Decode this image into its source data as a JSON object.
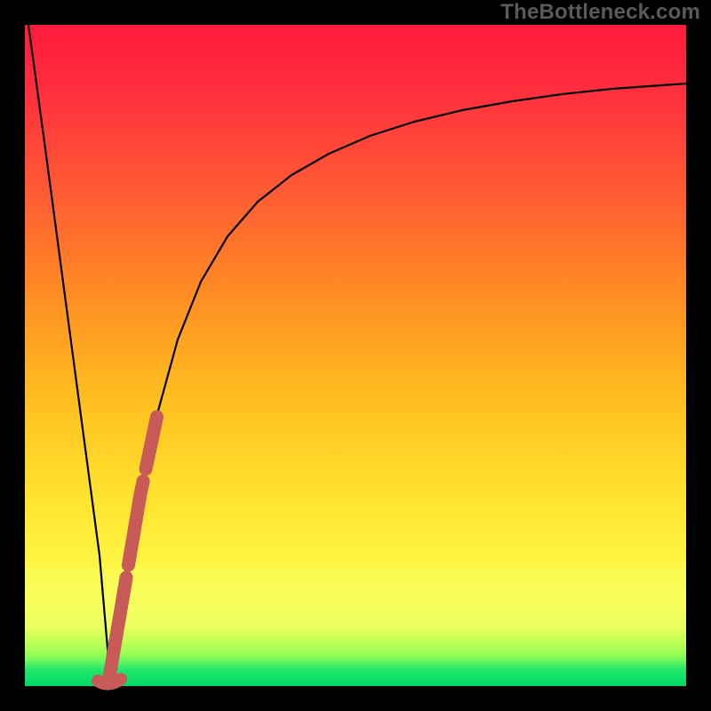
{
  "watermark": "TheBottleneck.com",
  "colors": {
    "frame": "#000000",
    "curve": "#000000",
    "highlight": "#c85a57",
    "grad_top": "#ff1a3c",
    "grad_mid1": "#ff522f",
    "grad_mid2": "#ff8a1f",
    "grad_mid3": "#ffc81a",
    "grad_mid4": "#fff23a",
    "grad_low": "#f8ff6a",
    "grad_band_top": "#eaff5e",
    "grad_band_bottom": "#b6ff55",
    "grad_green": "#00e36a"
  },
  "chart_data": {
    "type": "line",
    "title": "",
    "xlabel": "",
    "ylabel": "",
    "xlim": [
      0,
      100
    ],
    "ylim": [
      0,
      100
    ],
    "series": [
      {
        "name": "bottleneck-curve",
        "x": [
          0,
          3,
          6,
          9,
          12,
          12.5,
          15,
          18,
          21,
          24,
          27,
          30,
          34,
          38,
          42,
          46,
          50,
          55,
          60,
          65,
          70,
          75,
          80,
          85,
          90,
          95,
          100
        ],
        "y": [
          100,
          76,
          52,
          28,
          4,
          0,
          16,
          32,
          46,
          57,
          65,
          71,
          76,
          79.5,
          82,
          84,
          85.5,
          87,
          88.2,
          89.1,
          89.8,
          90.4,
          90.9,
          91.3,
          91.6,
          91.8,
          92
        ]
      }
    ],
    "highlight_segment": {
      "name": "highlight-band",
      "x_start": 12.2,
      "x_end": 24,
      "note": "Thick salmon dashed stroke overlaid on rising portion of curve"
    },
    "regions": [
      {
        "name": "top-red",
        "y_range": [
          95,
          100
        ],
        "color_key": "grad_top"
      },
      {
        "name": "red-orange",
        "y_range": [
          50,
          95
        ],
        "color_key": "grad_mid2"
      },
      {
        "name": "yellow",
        "y_range": [
          20,
          50
        ],
        "color_key": "grad_mid4"
      },
      {
        "name": "pale-band",
        "y_range": [
          10,
          20
        ],
        "color_key": "grad_band_top"
      },
      {
        "name": "green-strip",
        "y_range": [
          0,
          6
        ],
        "color_key": "grad_green"
      }
    ]
  }
}
